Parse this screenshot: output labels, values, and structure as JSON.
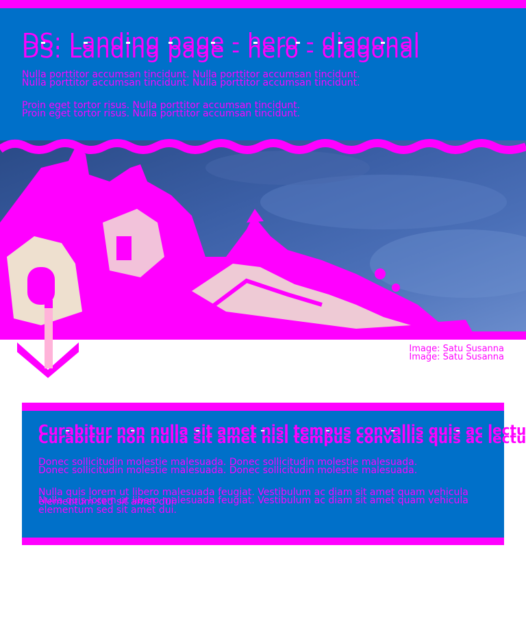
{
  "hero": {
    "title": "DS: Landing page - hero - diagonal",
    "paragraph_1": "Nulla porttitor accumsan tincidunt. Nulla porttitor accumsan tincidunt.",
    "paragraph_2": "Proin eget tortor risus. Nulla porttitor accumsan tincidunt."
  },
  "image": {
    "credit": "Image: Satu Susanna"
  },
  "card": {
    "title": "Curabitur non nulla sit amet nisl tempus convallis quis ac lectus",
    "paragraph_1": "Donec sollicitudin molestie malesuada. Donec sollicitudin molestie malesuada.",
    "paragraph_2": "Nulla quis lorem ut libero malesuada feugiat. Vestibulum ac diam sit amet quam vehicula elementum sed sit amet dui."
  },
  "colors": {
    "accent_magenta": "#ff00ff",
    "brand_blue": "#0070c9",
    "arrow_pink": "#ffb3d9"
  },
  "icons": {
    "scroll_down": "chevron-down-arrow-icon",
    "hero_wave": "wave-divider"
  }
}
